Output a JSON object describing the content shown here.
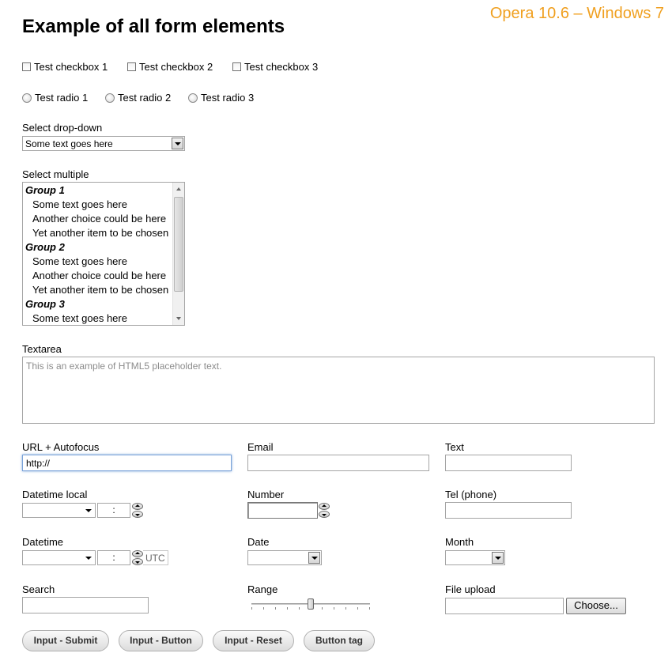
{
  "header": {
    "title": "Example of all form elements",
    "browser_tag": "Opera 10.6 – Windows 7"
  },
  "checkboxes": [
    {
      "label": "Test checkbox 1",
      "checked": false
    },
    {
      "label": "Test checkbox 2",
      "checked": false
    },
    {
      "label": "Test checkbox 3",
      "checked": false
    }
  ],
  "radios": [
    {
      "label": "Test radio 1",
      "checked": false
    },
    {
      "label": "Test radio 2",
      "checked": false
    },
    {
      "label": "Test radio 3",
      "checked": false
    }
  ],
  "select_dropdown": {
    "label": "Select drop-down",
    "selected": "Some text goes here"
  },
  "select_multiple": {
    "label": "Select multiple",
    "rows": [
      {
        "type": "group",
        "text": "Group 1"
      },
      {
        "type": "option",
        "text": "Some text goes here"
      },
      {
        "type": "option",
        "text": "Another choice could be here"
      },
      {
        "type": "option",
        "text": "Yet another item to be chosen"
      },
      {
        "type": "group",
        "text": "Group 2"
      },
      {
        "type": "option",
        "text": "Some text goes here"
      },
      {
        "type": "option",
        "text": "Another choice could be here"
      },
      {
        "type": "option",
        "text": "Yet another item to be chosen"
      },
      {
        "type": "group",
        "text": "Group 3"
      },
      {
        "type": "option",
        "text": "Some text goes here"
      }
    ]
  },
  "textarea": {
    "label": "Textarea",
    "placeholder": "This is an example of HTML5 placeholder text."
  },
  "url": {
    "label": "URL + Autofocus",
    "value": "http://"
  },
  "email": {
    "label": "Email",
    "value": ""
  },
  "text": {
    "label": "Text",
    "value": ""
  },
  "datetime_local": {
    "label": "Datetime local",
    "time_separator": ":"
  },
  "number": {
    "label": "Number",
    "value": ""
  },
  "tel": {
    "label": "Tel (phone)",
    "value": ""
  },
  "datetime": {
    "label": "Datetime",
    "time_separator": ":",
    "timezone": "UTC"
  },
  "date": {
    "label": "Date"
  },
  "month": {
    "label": "Month"
  },
  "search": {
    "label": "Search",
    "value": ""
  },
  "range": {
    "label": "Range",
    "value_fraction": 0.5,
    "ticks": 11
  },
  "file_upload": {
    "label": "File upload",
    "button_label": "Choose..."
  },
  "buttons": {
    "submit": "Input - Submit",
    "button": "Input - Button",
    "reset": "Input - Reset",
    "button_tag": "Button tag"
  }
}
